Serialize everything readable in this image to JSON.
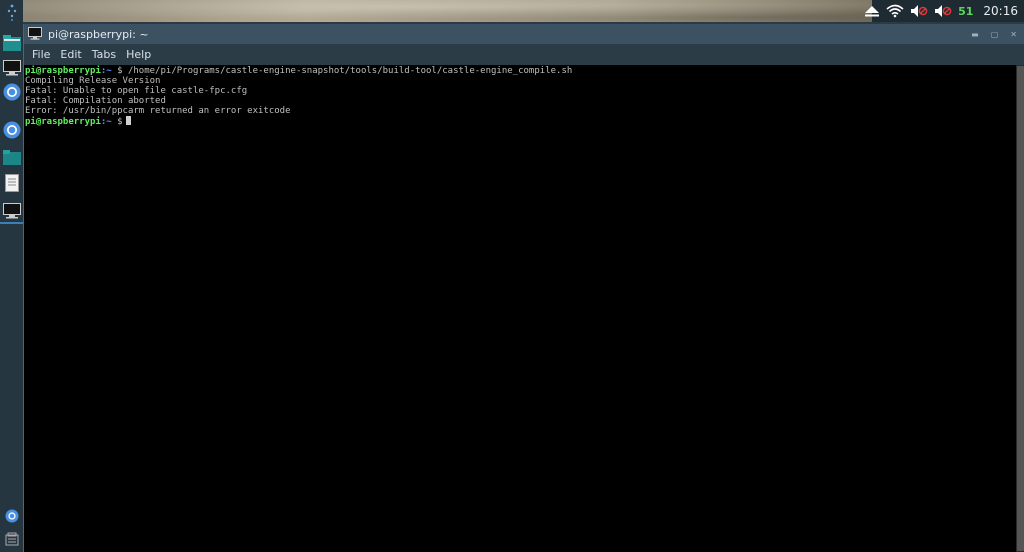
{
  "window": {
    "title": "pi@raspberrypi: ~"
  },
  "menu": {
    "file": "File",
    "edit": "Edit",
    "tabs": "Tabs",
    "help": "Help"
  },
  "tray": {
    "battery_value": "51",
    "clock": "20:16"
  },
  "terminal": {
    "line1": {
      "user": "pi@raspberrypi",
      "path": ":~",
      "sign": " $ ",
      "command": "/home/pi/Programs/castle-engine-snapshot/tools/build-tool/castle-engine_compile.sh"
    },
    "output": [
      "Compiling Release Version",
      "Fatal: Unable to open file castle-fpc.cfg",
      "Fatal: Compilation aborted",
      "Error: /usr/bin/ppcarm returned an error exitcode"
    ],
    "line6": {
      "user": "pi@raspberrypi",
      "path": ":~",
      "sign": " $"
    }
  },
  "icons": {
    "launcher": [
      "raspberry-menu-icon",
      "file-manager-icon",
      "terminal-icon",
      "chromium-icon",
      "chromium-icon",
      "folder-icon",
      "text-editor-icon",
      "terminal-icon",
      "chromium-small-icon",
      "settings-icon"
    ],
    "tray": [
      "eject-icon",
      "wifi-icon",
      "volume-muted-icon",
      "volume-muted-icon"
    ]
  },
  "colors": {
    "prompt_user": "#5ff05f",
    "prompt_path": "#5c8cff",
    "battery": "#5bd65b"
  }
}
